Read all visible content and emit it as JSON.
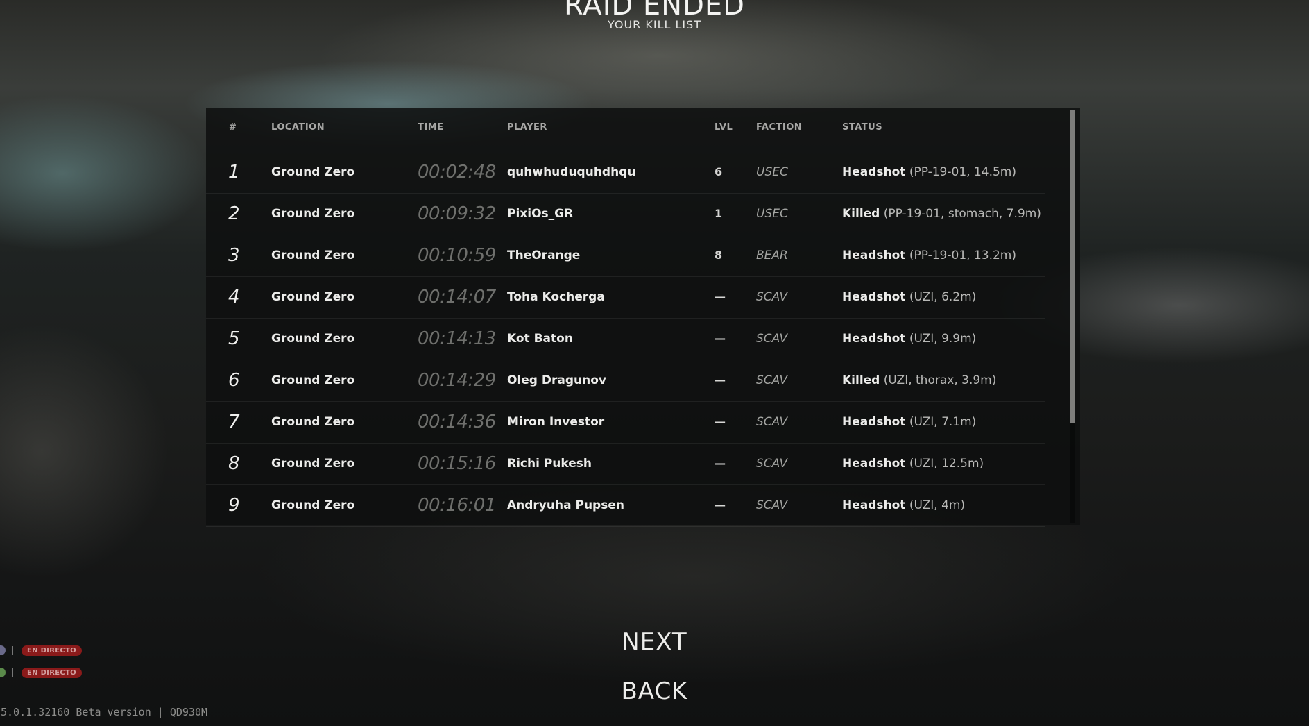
{
  "header": {
    "title": "RAID ENDED",
    "subtitle": "YOUR KILL LIST"
  },
  "table": {
    "columns": [
      "#",
      "LOCATION",
      "TIME",
      "PLAYER",
      "LVL",
      "FACTION",
      "STATUS"
    ],
    "rows": [
      {
        "num": "1",
        "location": "Ground Zero",
        "time": "00:02:48",
        "player": "quhwhuduquhdhqu",
        "lvl": "6",
        "faction": "USEC",
        "status_type": "Headshot",
        "status_detail": "(PP-19-01, 14.5m)"
      },
      {
        "num": "2",
        "location": "Ground Zero",
        "time": "00:09:32",
        "player": "PixiOs_GR",
        "lvl": "1",
        "faction": "USEC",
        "status_type": "Killed",
        "status_detail": "(PP-19-01, stomach, 7.9m)"
      },
      {
        "num": "3",
        "location": "Ground Zero",
        "time": "00:10:59",
        "player": "TheOrange",
        "lvl": "8",
        "faction": "BEAR",
        "status_type": "Headshot",
        "status_detail": "(PP-19-01, 13.2m)"
      },
      {
        "num": "4",
        "location": "Ground Zero",
        "time": "00:14:07",
        "player": "Toha Kocherga",
        "lvl": "—",
        "faction": "SCAV",
        "status_type": "Headshot",
        "status_detail": "(UZI, 6.2m)"
      },
      {
        "num": "5",
        "location": "Ground Zero",
        "time": "00:14:13",
        "player": "Kot Baton",
        "lvl": "—",
        "faction": "SCAV",
        "status_type": "Headshot",
        "status_detail": "(UZI, 9.9m)"
      },
      {
        "num": "6",
        "location": "Ground Zero",
        "time": "00:14:29",
        "player": "Oleg Dragunov",
        "lvl": "—",
        "faction": "SCAV",
        "status_type": "Killed",
        "status_detail": "(UZI, thorax, 3.9m)"
      },
      {
        "num": "7",
        "location": "Ground Zero",
        "time": "00:14:36",
        "player": "Miron Investor",
        "lvl": "—",
        "faction": "SCAV",
        "status_type": "Headshot",
        "status_detail": "(UZI, 7.1m)"
      },
      {
        "num": "8",
        "location": "Ground Zero",
        "time": "00:15:16",
        "player": "Richi Pukesh",
        "lvl": "—",
        "faction": "SCAV",
        "status_type": "Headshot",
        "status_detail": "(UZI, 12.5m)"
      },
      {
        "num": "9",
        "location": "Ground Zero",
        "time": "00:16:01",
        "player": "Andryuha Pupsen",
        "lvl": "—",
        "faction": "SCAV",
        "status_type": "Headshot",
        "status_detail": "(UZI, 4m)"
      }
    ]
  },
  "buttons": {
    "next": "NEXT",
    "back": "BACK"
  },
  "overlay": {
    "live_badges": [
      "EN DIRECTO",
      "EN DIRECTO"
    ],
    "version": "5.0.1.32160 Beta version | QD930M"
  }
}
